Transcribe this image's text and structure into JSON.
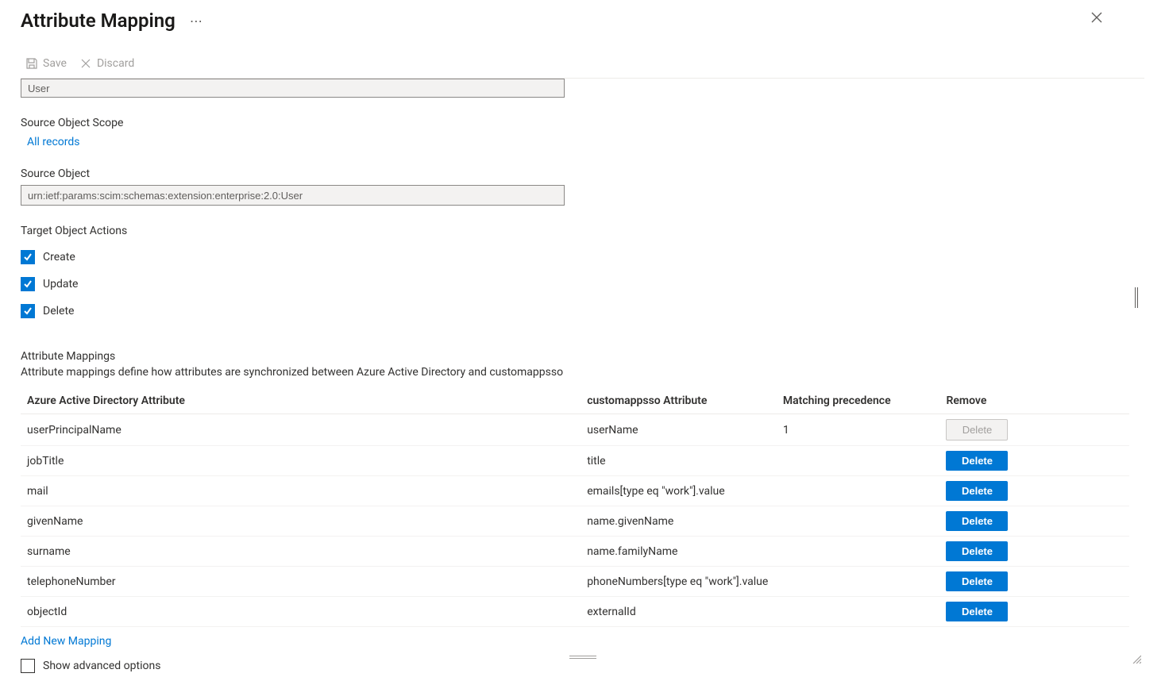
{
  "header": {
    "title": "Attribute Mapping"
  },
  "toolbar": {
    "save_label": "Save",
    "discard_label": "Discard"
  },
  "fields": {
    "user_input_value": "User",
    "source_scope_label": "Source Object Scope",
    "source_scope_link": "All records",
    "source_object_label": "Source Object",
    "source_object_value": "urn:ietf:params:scim:schemas:extension:enterprise:2.0:User",
    "target_actions_label": "Target Object Actions",
    "actions": {
      "create": {
        "label": "Create",
        "checked": true
      },
      "update": {
        "label": "Update",
        "checked": true
      },
      "delete": {
        "label": "Delete",
        "checked": true
      }
    }
  },
  "mappings_section": {
    "title": "Attribute Mappings",
    "description": "Attribute mappings define how attributes are synchronized between Azure Active Directory and customappsso",
    "columns": {
      "aad": "Azure Active Directory Attribute",
      "target": "customappsso Attribute",
      "precedence": "Matching precedence",
      "remove": "Remove"
    },
    "rows": [
      {
        "aad": "userPrincipalName",
        "target": "userName",
        "precedence": "1",
        "delete_label": "Delete",
        "delete_enabled": false
      },
      {
        "aad": "jobTitle",
        "target": "title",
        "precedence": "",
        "delete_label": "Delete",
        "delete_enabled": true
      },
      {
        "aad": "mail",
        "target": "emails[type eq \"work\"].value",
        "precedence": "",
        "delete_label": "Delete",
        "delete_enabled": true
      },
      {
        "aad": "givenName",
        "target": "name.givenName",
        "precedence": "",
        "delete_label": "Delete",
        "delete_enabled": true
      },
      {
        "aad": "surname",
        "target": "name.familyName",
        "precedence": "",
        "delete_label": "Delete",
        "delete_enabled": true
      },
      {
        "aad": "telephoneNumber",
        "target": "phoneNumbers[type eq \"work\"].value",
        "precedence": "",
        "delete_label": "Delete",
        "delete_enabled": true
      },
      {
        "aad": "objectId",
        "target": "externalId",
        "precedence": "",
        "delete_label": "Delete",
        "delete_enabled": true
      }
    ],
    "add_new_label": "Add New Mapping",
    "show_advanced_label": "Show advanced options",
    "show_advanced_checked": false
  }
}
